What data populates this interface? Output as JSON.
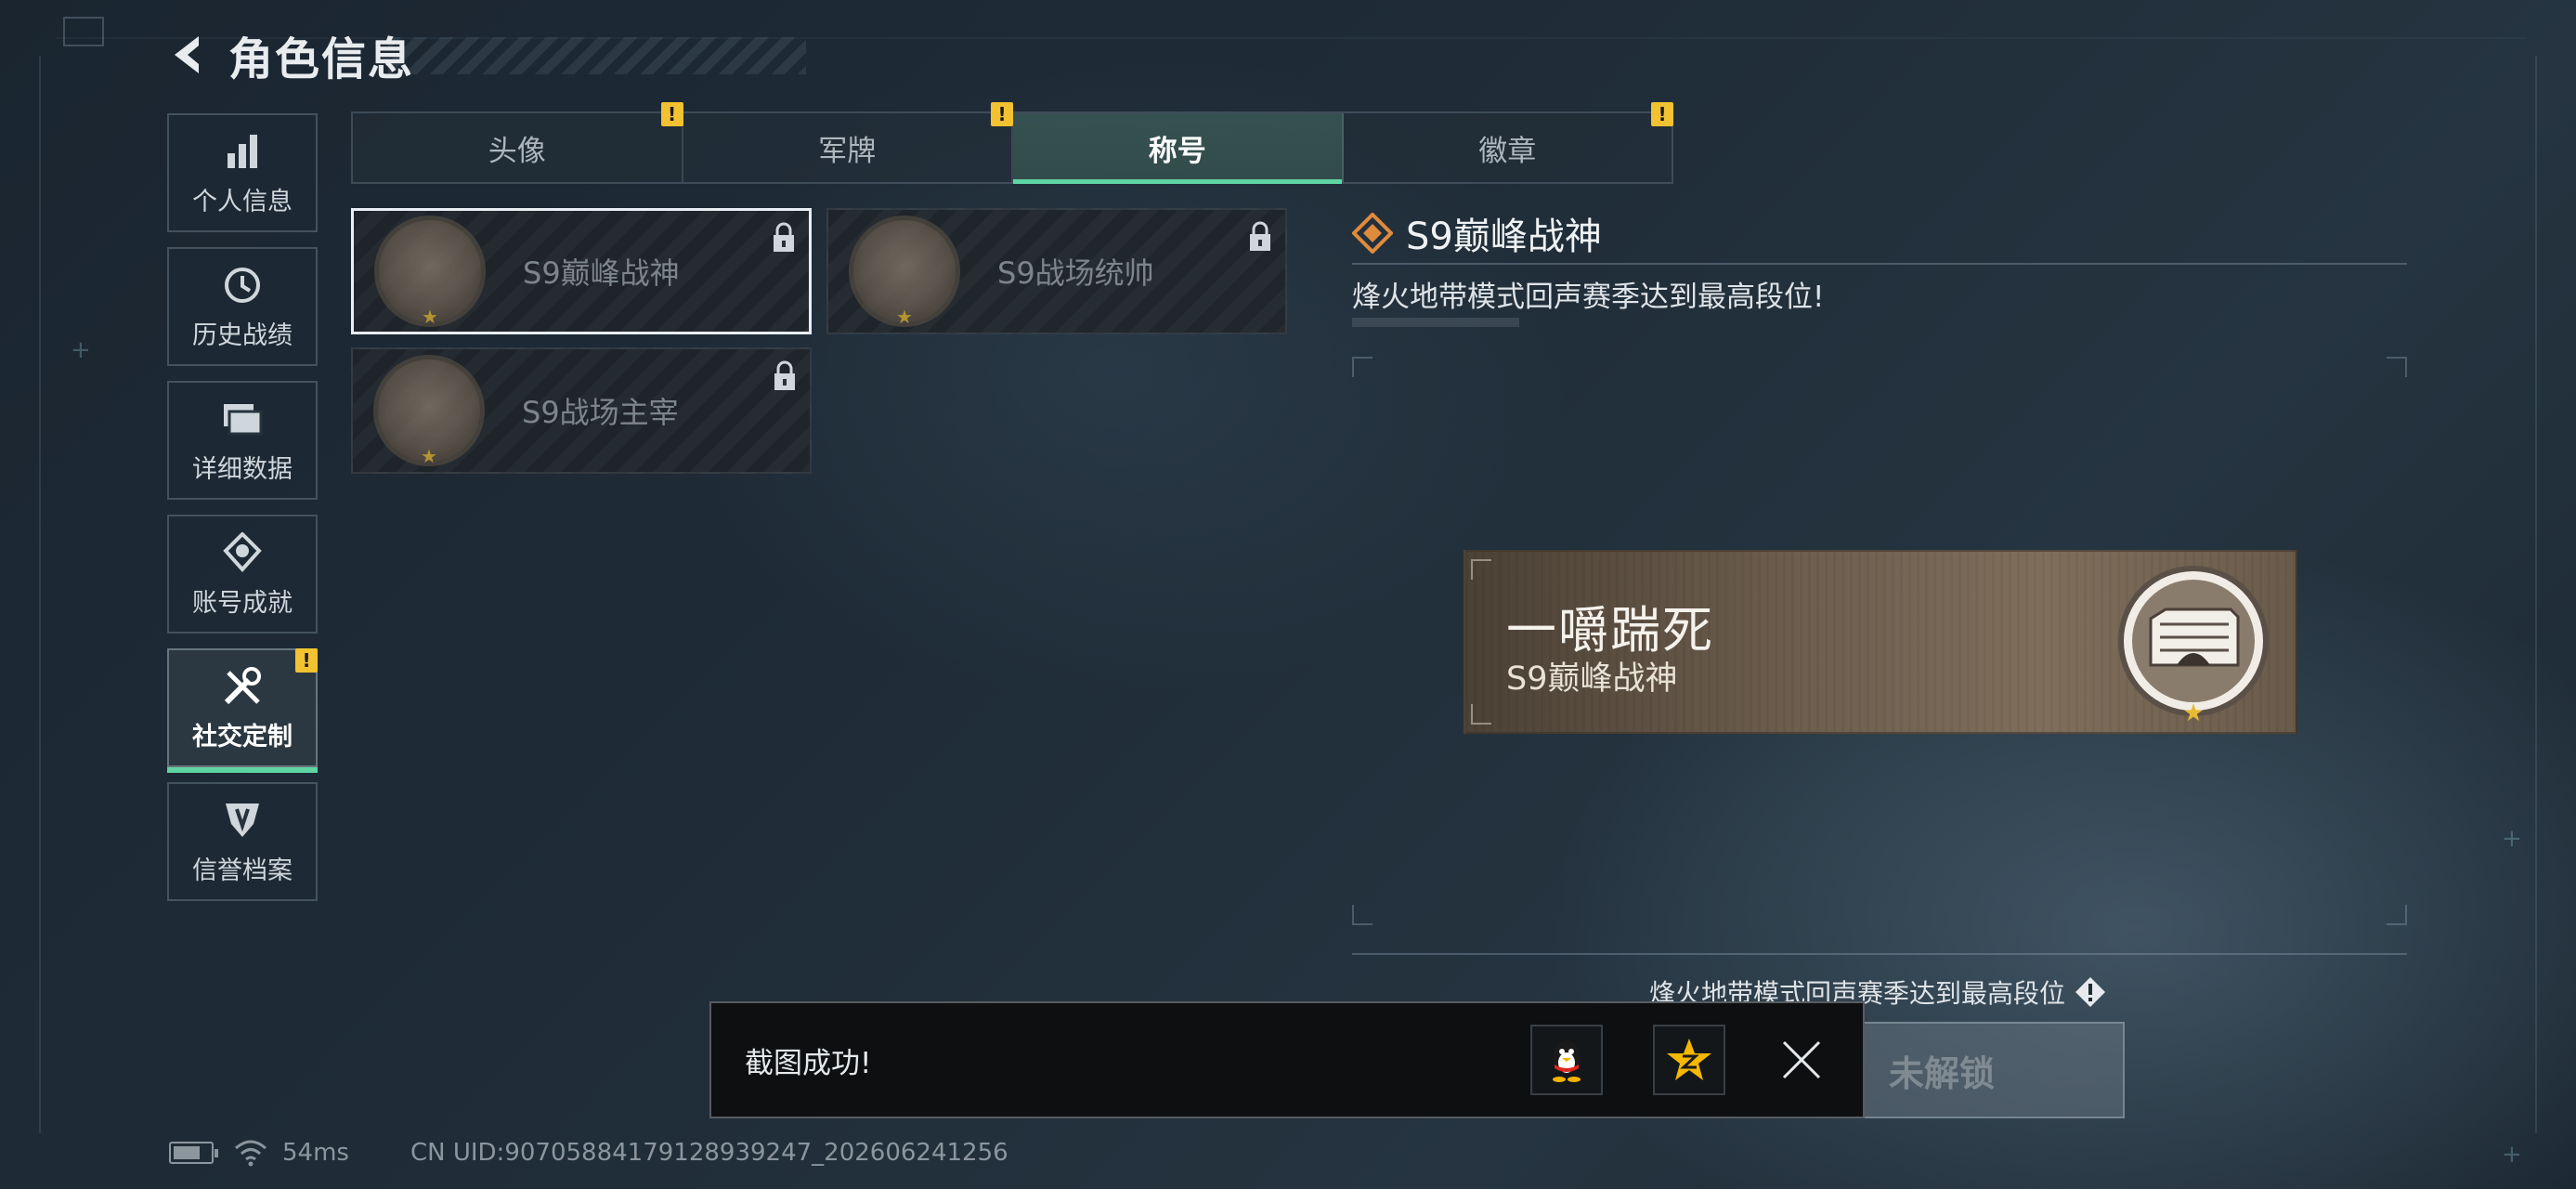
{
  "header": {
    "title": "角色信息"
  },
  "sidebar": {
    "items": [
      {
        "label": "个人信息",
        "icon": "bar-chart-icon"
      },
      {
        "label": "历史战绩",
        "icon": "history-clock-icon"
      },
      {
        "label": "详细数据",
        "icon": "folder-icon"
      },
      {
        "label": "账号成就",
        "icon": "medal-icon"
      },
      {
        "label": "社交定制",
        "icon": "tools-icon",
        "active": true,
        "alert": "!"
      },
      {
        "label": "信誉档案",
        "icon": "shield-emblem-icon"
      }
    ]
  },
  "tabs": [
    {
      "label": "头像",
      "alert": "!"
    },
    {
      "label": "军牌",
      "alert": "!"
    },
    {
      "label": "称号",
      "active": true
    },
    {
      "label": "徽章",
      "alert": "!"
    }
  ],
  "titles": [
    {
      "name": "S9巅峰战神",
      "selected": true,
      "locked": true
    },
    {
      "name": "S9战场统帅",
      "locked": true
    },
    {
      "name": "S9战场主宰",
      "locked": true
    }
  ],
  "detail": {
    "title": "S9巅峰战神",
    "description": "烽火地带模式回声赛季达到最高段位!"
  },
  "preview": {
    "player_name": "一嚼踹死",
    "title_name": "S9巅峰战神"
  },
  "unlock": {
    "condition": "烽火地带模式回声赛季达到最高段位",
    "button_label": "未解锁"
  },
  "toast": {
    "message": "截图成功!"
  },
  "status_bar": {
    "ping": "54ms",
    "uid": "CN UID:9070588417912893924​7_202606241256"
  },
  "colors": {
    "accent_green": "#5ed4a2",
    "alert_yellow": "#f2c230",
    "diamond_orange": "#e08a3c"
  }
}
